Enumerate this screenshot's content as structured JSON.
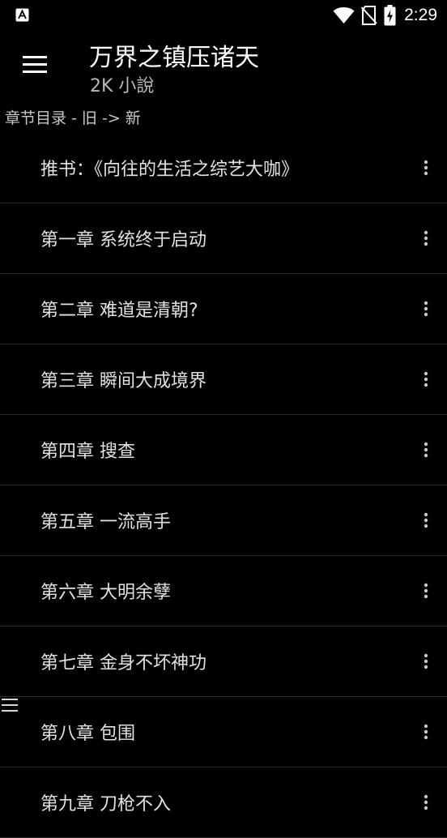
{
  "status_bar": {
    "time": "2:29",
    "left_icon": "app-notification-icon",
    "icons": [
      "wifi-icon",
      "no-sim-icon",
      "battery-charging-icon"
    ]
  },
  "app_bar": {
    "title": "万界之镇压诸天",
    "subtitle": "2K 小說",
    "menu_icon": "hamburger-menu-icon"
  },
  "section": {
    "label": "章节目录 - 旧 -> 新"
  },
  "chapters": [
    {
      "title": "推书：《向往的生活之综艺大咖》"
    },
    {
      "title": "第一章 系统终于启动"
    },
    {
      "title": "第二章 难道是清朝?"
    },
    {
      "title": "第三章 瞬间大成境界"
    },
    {
      "title": "第四章 搜查"
    },
    {
      "title": "第五章 一流高手"
    },
    {
      "title": "第六章 大明余孽"
    },
    {
      "title": "第七章 金身不坏神功"
    },
    {
      "title": "第八章 包围"
    },
    {
      "title": "第九章 刀枪不入"
    }
  ],
  "colors": {
    "background": "#000000",
    "text_primary": "#ffffff",
    "text_secondary": "#b8b8b8",
    "divider": "#2b2b2b"
  }
}
